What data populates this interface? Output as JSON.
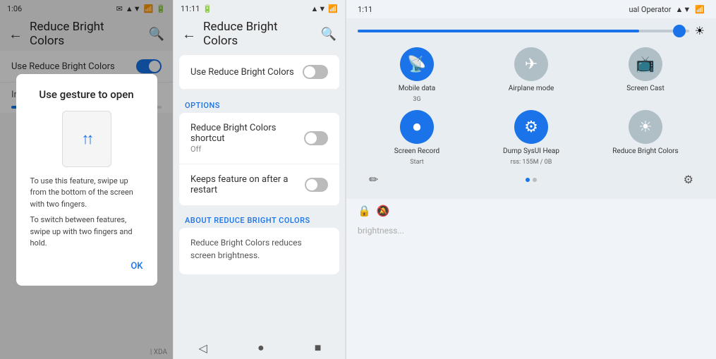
{
  "panel1": {
    "status_bar": {
      "time": "1:06",
      "icons_right": [
        "message-icon",
        "wifi-icon",
        "signal-icon",
        "battery-icon"
      ]
    },
    "toolbar": {
      "back_label": "←",
      "title": "Reduce Bright Colors",
      "search_label": "🔍"
    },
    "use_row": {
      "label": "Use Reduce Bright Colors"
    },
    "intensity_label": "Intensity",
    "dialog": {
      "title": "Use gesture to open",
      "text1": "To use this feature, swipe up from the bottom of the screen with two fingers.",
      "text2": "To switch between features, swipe up with two fingers and hold.",
      "ok_label": "OK"
    },
    "xda_watermark": "| XDA"
  },
  "panel2": {
    "status_bar": {
      "time": "11:11",
      "battery_icon": "🔋",
      "wifi_label": "▲▼",
      "signal_label": "📶"
    },
    "toolbar": {
      "back_label": "←",
      "title": "Reduce Bright Colors",
      "search_label": "🔍"
    },
    "use_row": {
      "label": "Use Reduce Bright Colors"
    },
    "options_header": "OPTIONS",
    "shortcut_row": {
      "title": "Reduce Bright Colors shortcut",
      "sub": "Off"
    },
    "keeps_row": {
      "title": "Keeps feature on after a restart"
    },
    "about_header": "ABOUT REDUCE BRIGHT COLORS",
    "about_text": "Reduce Bright Colors reduces screen brightness.",
    "nav": {
      "back": "◁",
      "home": "●",
      "recents": "■"
    }
  },
  "panel3": {
    "status_bar": {
      "time": "1:11",
      "operator": "ual Operator",
      "wifi": "▲▼",
      "signal": "📶"
    },
    "brightness": {
      "fill_percent": 85
    },
    "tiles": [
      {
        "label": "Mobile data",
        "sub": "3G",
        "icon": "📡",
        "state": "active"
      },
      {
        "label": "Airplane mode",
        "sub": "",
        "icon": "✈",
        "state": "inactive"
      },
      {
        "label": "Screen Cast",
        "sub": "",
        "icon": "📺",
        "state": "inactive"
      },
      {
        "label": "Screen Record",
        "sub": "Start",
        "icon": "⏺",
        "state": "active"
      },
      {
        "label": "Dump SysUI Heap",
        "sub": "rss: 155M / 0B",
        "icon": "⚙",
        "state": "active"
      },
      {
        "label": "Reduce Bright Colors",
        "sub": "",
        "icon": "☀",
        "state": "inactive"
      }
    ],
    "actions": {
      "edit_icon": "✏",
      "settings_icon": "⚙"
    },
    "notif": {
      "lock_icon": "🔒",
      "mute_icon": "🔕"
    },
    "brightness_hint": "brightness..."
  }
}
